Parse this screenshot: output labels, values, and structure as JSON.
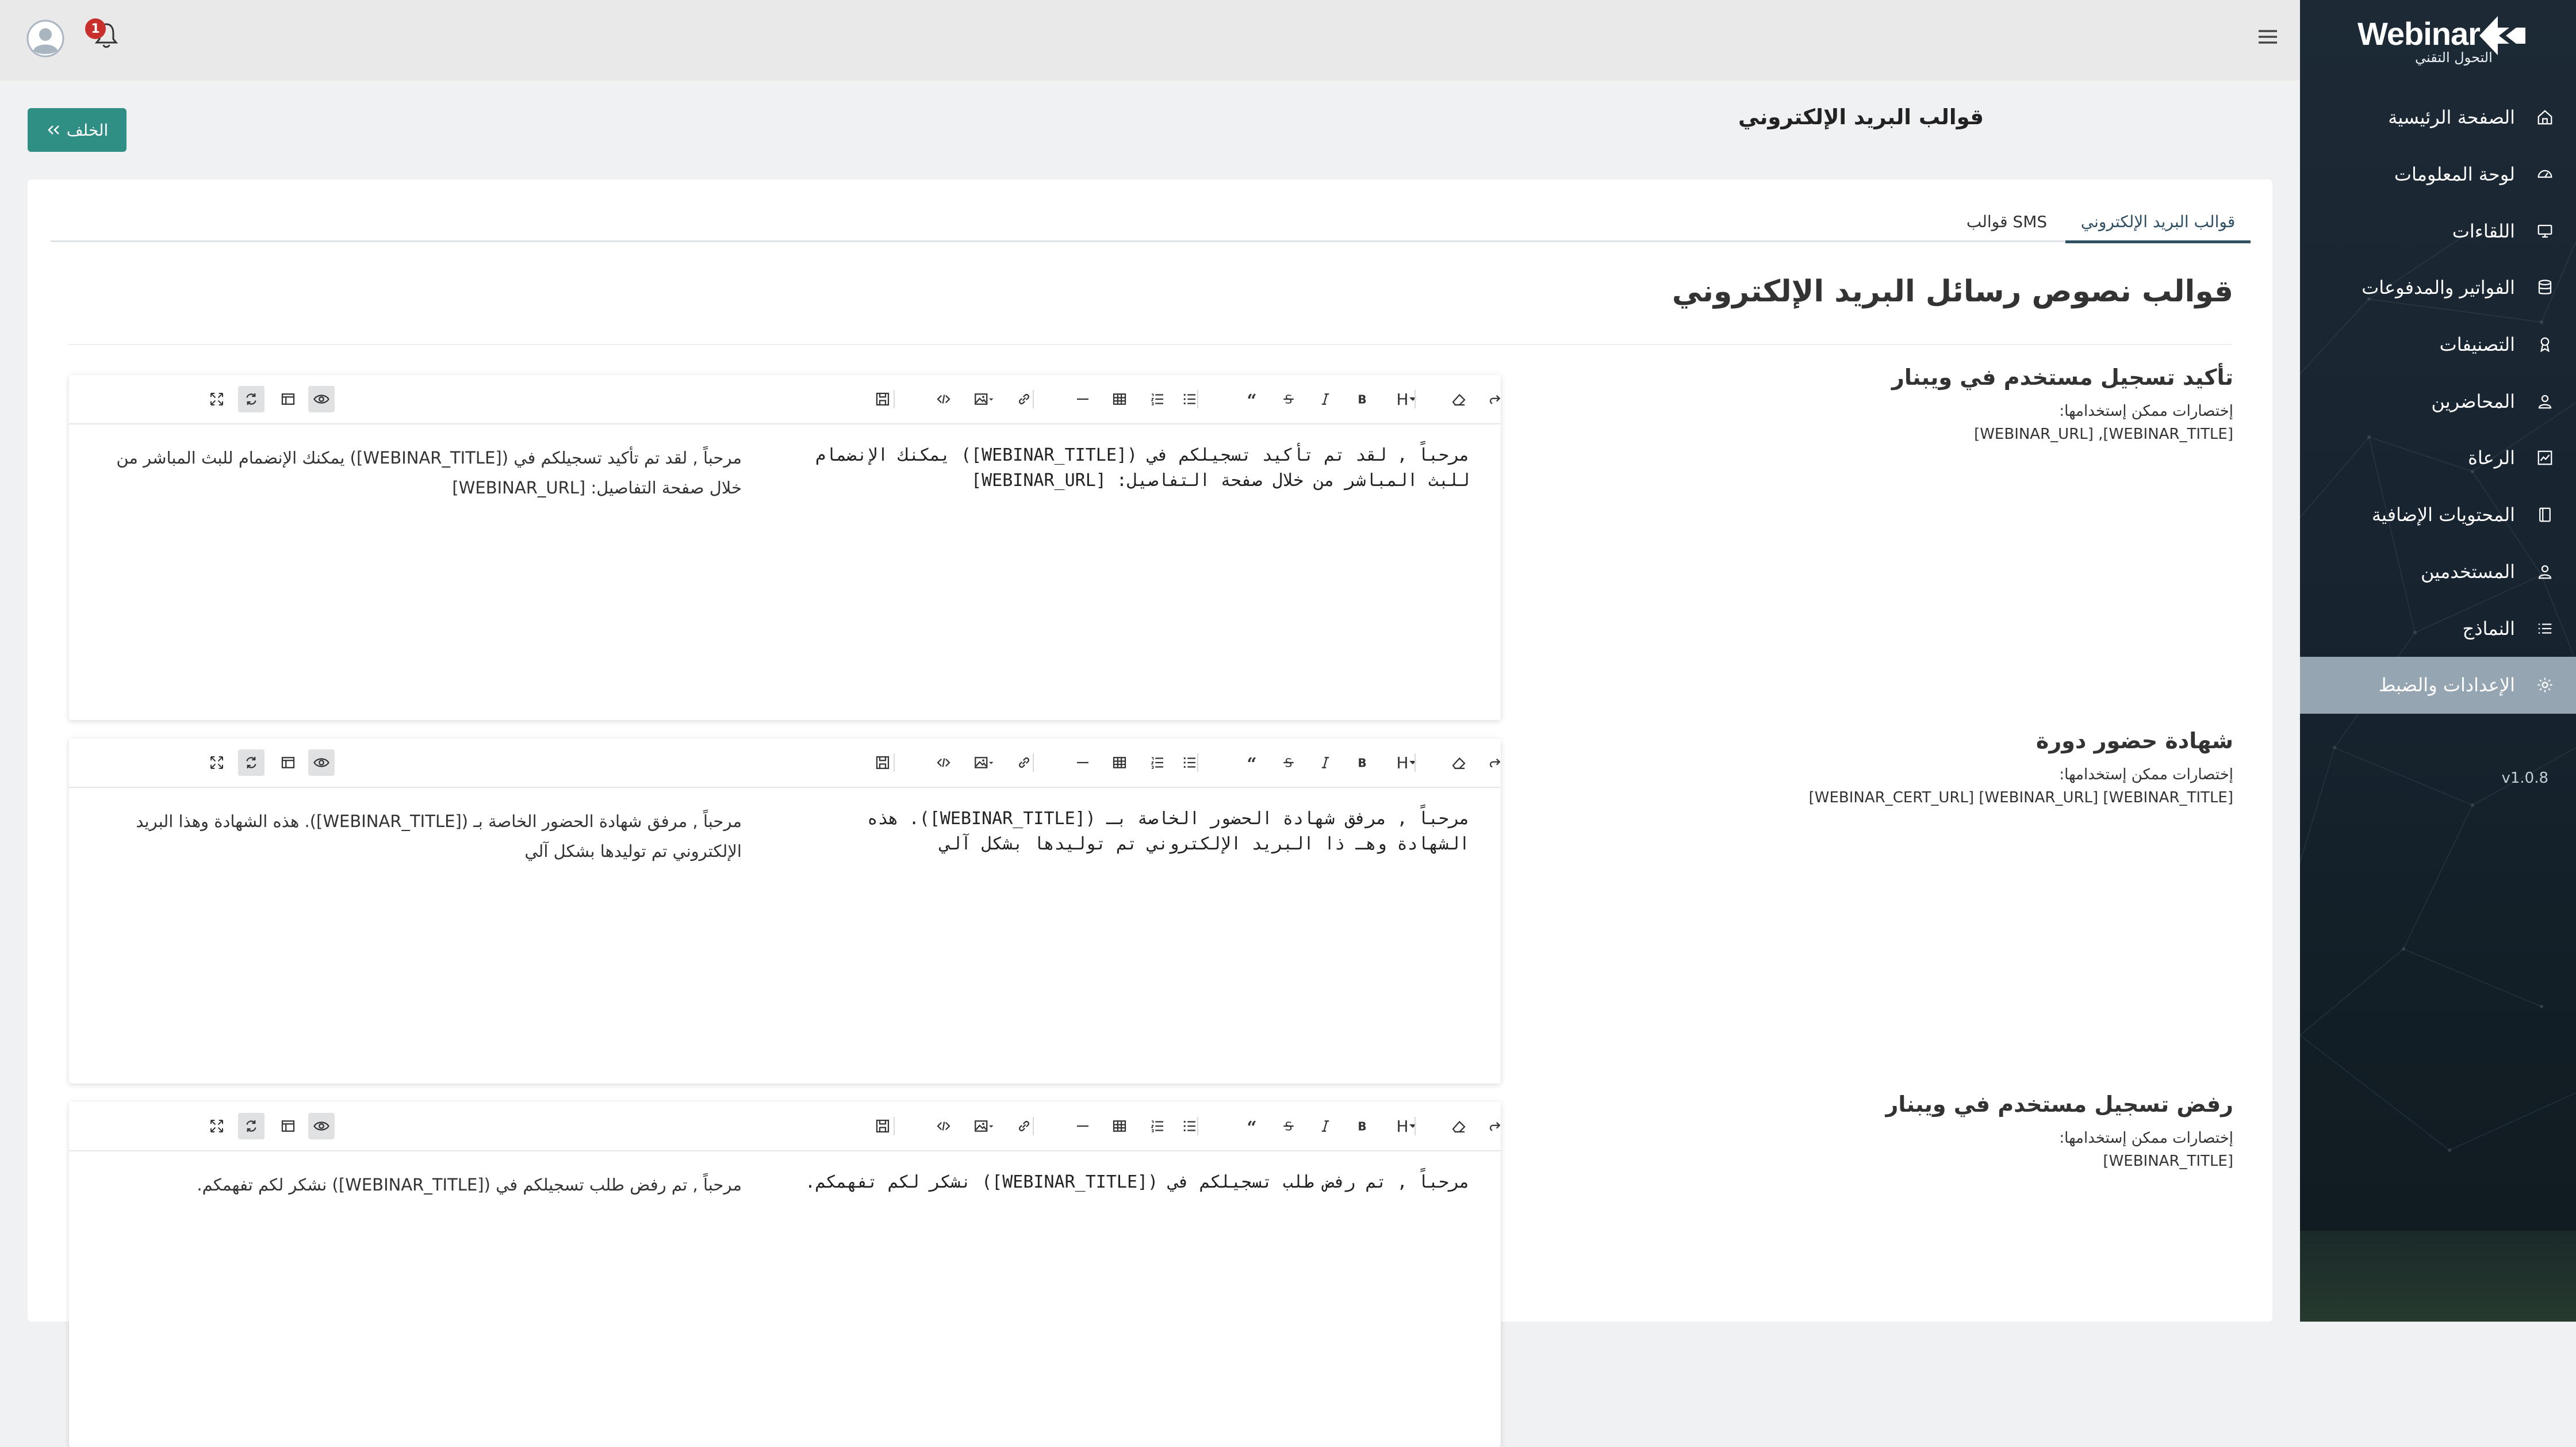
{
  "app": {
    "logo_text": "Webinar",
    "logo_subtitle": "التحول التقني",
    "version": "v1.0.8"
  },
  "sidebar": {
    "items": [
      {
        "label": "الصفحة الرئيسية",
        "icon": "home-icon"
      },
      {
        "label": "لوحة المعلومات",
        "icon": "dashboard-icon"
      },
      {
        "label": "اللقاءات",
        "icon": "monitor-icon"
      },
      {
        "label": "الفواتير والمدفوعات",
        "icon": "database-icon"
      },
      {
        "label": "التصنيفات",
        "icon": "badge-icon"
      },
      {
        "label": "المحاضرين",
        "icon": "user-icon"
      },
      {
        "label": "الرعاة",
        "icon": "chart-icon"
      },
      {
        "label": "المحتويات الإضافية",
        "icon": "book-icon"
      },
      {
        "label": "المستخدمين",
        "icon": "user-icon"
      },
      {
        "label": "النماذج",
        "icon": "list-icon"
      },
      {
        "label": "الإعدادات والضبط",
        "icon": "gear-icon",
        "active": true
      }
    ]
  },
  "topbar": {
    "notification_count": "1"
  },
  "page": {
    "title": "قوالب البريد الإلكتروني",
    "back_label": "الخلف"
  },
  "tabs": [
    {
      "label": "قوالب البريد الإلكتروني",
      "active": true
    },
    {
      "label": "قوالب SMS",
      "active": false
    }
  ],
  "section_title": "قوالب نصوص رسائل البريد الإلكتروني",
  "templates": [
    {
      "name": "تأكيد تسجيل مستخدم في ويبنار",
      "hint": "إختصارات ممكن إستخدامها:",
      "codes": "[WEBINAR_URL] ,[WEBINAR_TITLE]",
      "source": "مرحباً , لقد تم تأكيد تسجيلكم في ([WEBINAR_TITLE]) يمكنك الإنضمام للبث المباشر من خلال صفحة التفاصيل: [WEBINAR_URL]",
      "preview": "مرحباً , لقد تم تأكيد تسجيلكم في ([WEBINAR_TITLE]) يمكنك الإنضمام للبث المباشر من خلال صفحة التفاصيل: [WEBINAR_URL]"
    },
    {
      "name": "شهادة حضور دورة",
      "hint": "إختصارات ممكن إستخدامها:",
      "codes": "[WEBINAR_CERT_URL] [WEBINAR_URL] [WEBINAR_TITLE]",
      "source": "مرحباً , مرفق شهادة الحضور الخاصة بـ ([WEBINAR_TITLE]). هذه الشهادة وهـ ذا البريد الإلكتروني تم توليدها بشكل آلي",
      "preview": "مرحباً , مرفق شهادة الحضور الخاصة بـ ([WEBINAR_TITLE]). هذه الشهادة وهذا البريد الإلكتروني تم توليدها بشكل آلي"
    },
    {
      "name": "رفض تسجيل مستخدم في ويبنار",
      "hint": "إختصارات ممكن إستخدامها:",
      "codes": "[WEBINAR_TITLE]",
      "source": "مرحباً , تم رفض طلب تسجيلكم في ([WEBINAR_TITLE]) نشكر لكم تفهمكم.",
      "preview": "مرحباً , تم رفض طلب تسجيلكم في ([WEBINAR_TITLE]) نشكر لكم تفهمكم."
    }
  ],
  "toolbar": {
    "heading_label": "H"
  },
  "colors": {
    "accent": "#2f8f84",
    "sidebar": "#1d2a36",
    "active_item": "#95a5b2",
    "badge": "#c9302c"
  }
}
